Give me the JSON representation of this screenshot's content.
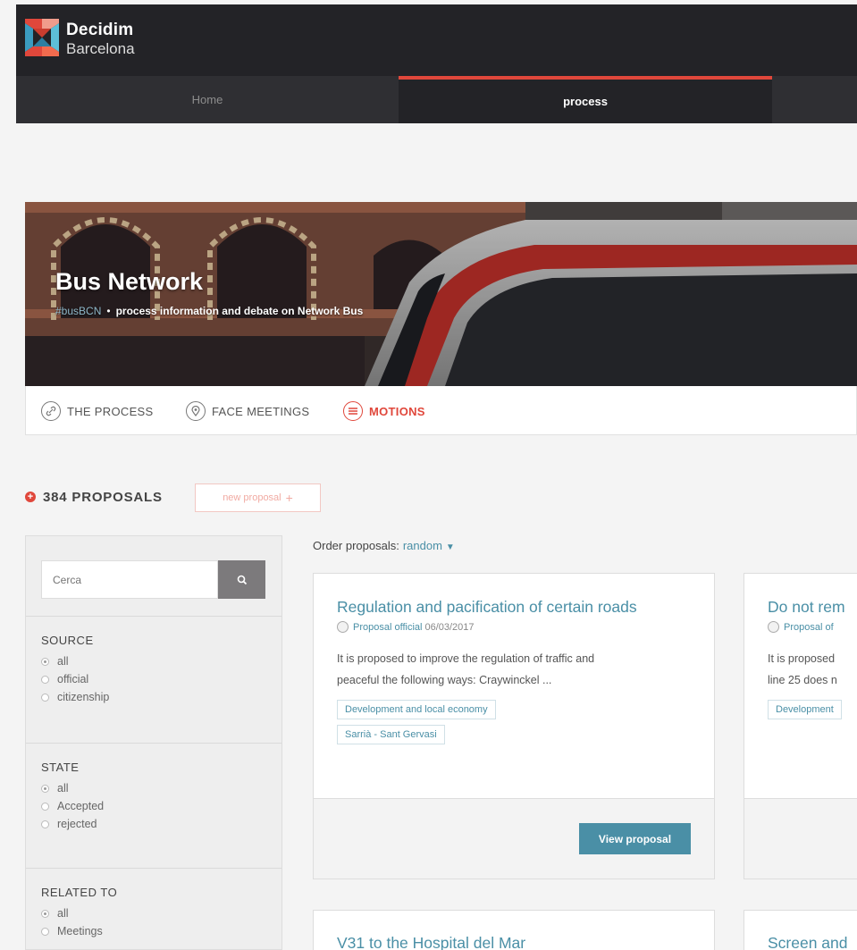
{
  "brand": {
    "line1": "Decidim",
    "line2": "Barcelona"
  },
  "nav": {
    "home": "Home",
    "process": "process"
  },
  "hero": {
    "title": "Bus Network",
    "hashtag": "#busBCN",
    "separator": "•",
    "description": "process information and debate on Network Bus"
  },
  "subnav": {
    "items": [
      {
        "label": "THE PROCESS",
        "icon": "link-icon"
      },
      {
        "label": "FACE MEETINGS",
        "icon": "location-pin-icon"
      },
      {
        "label": "MOTIONS",
        "icon": "list-icon"
      }
    ]
  },
  "proposals": {
    "count_label": "384 PROPOSALS",
    "new_button": "new proposal",
    "plus": "+"
  },
  "search": {
    "placeholder": "Cerca"
  },
  "filters": {
    "source": {
      "title": "SOURCE",
      "options": [
        "all",
        "official",
        "citizenship"
      ]
    },
    "state": {
      "title": "STATE",
      "options": [
        "all",
        "Accepted",
        "rejected"
      ]
    },
    "related": {
      "title": "RELATED TO",
      "options": [
        "all",
        "Meetings"
      ]
    }
  },
  "order": {
    "label": "Order proposals:",
    "value": "random"
  },
  "cards": [
    {
      "title": "Regulation and pacification of certain roads",
      "author": "Proposal official",
      "date": "06/03/2017",
      "text1": "It is proposed to improve the regulation of traffic and",
      "text2": "peaceful the following ways: Craywinckel ...",
      "chip1": "Development and local economy",
      "chip2": "Sarrià - Sant Gervasi",
      "button": "View proposal"
    },
    {
      "title": "Do not rem",
      "author": "Proposal of",
      "date": "",
      "text1": "It is proposed",
      "text2": "line 25 does n",
      "chip1": "Development",
      "chip2": "",
      "button": ""
    },
    {
      "title": "V31 to the Hospital del Mar"
    },
    {
      "title": "Screen and"
    }
  ],
  "colors": {
    "accent": "#e0473b",
    "link": "#4a8fa6",
    "topbar": "#232327"
  }
}
